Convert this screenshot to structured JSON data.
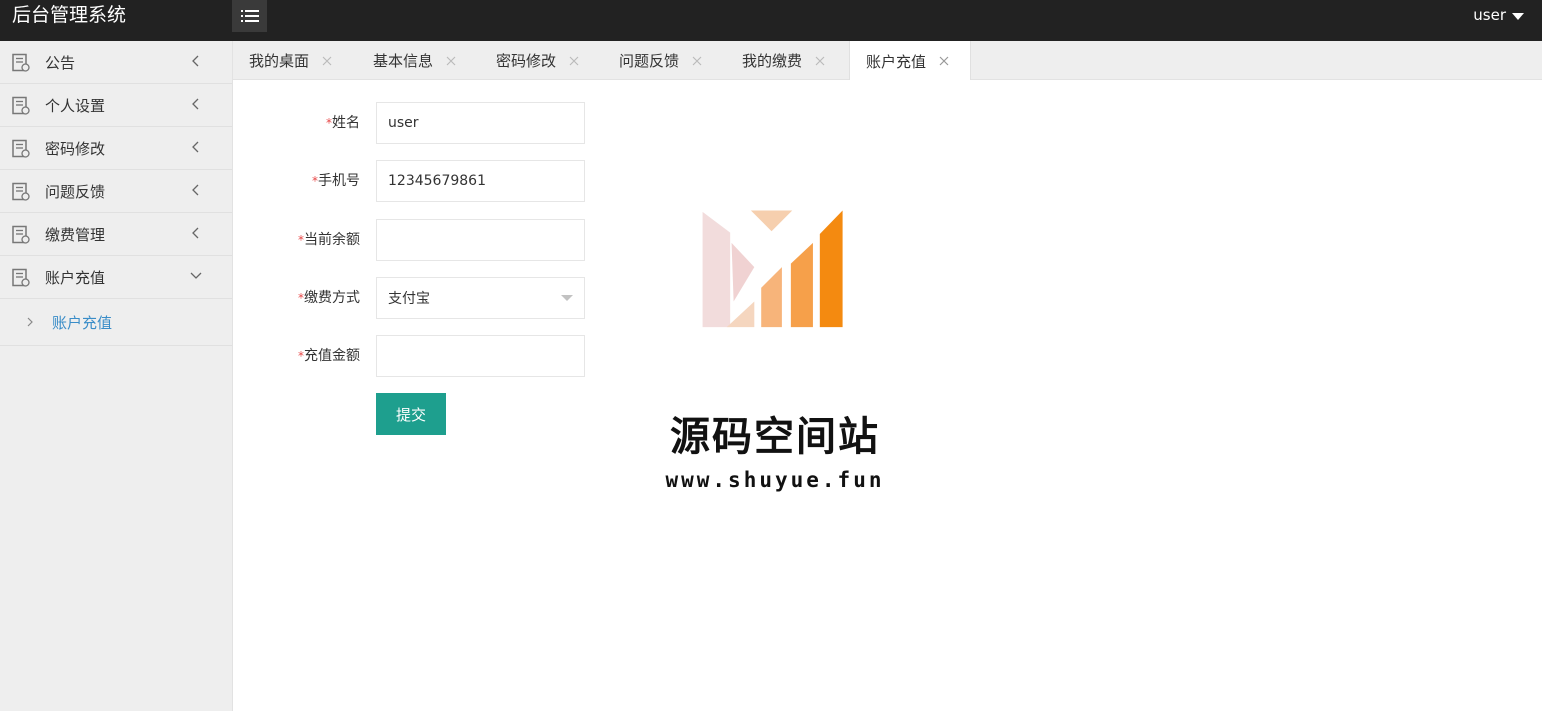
{
  "app": {
    "title": "后台管理系统",
    "menu_icon": "hamburger-icon",
    "user": "user"
  },
  "sidebar": {
    "items": [
      {
        "label": "公告",
        "icon": "document-icon",
        "state": "collapsed"
      },
      {
        "label": "个人设置",
        "icon": "document-icon",
        "state": "collapsed"
      },
      {
        "label": "密码修改",
        "icon": "document-icon",
        "state": "collapsed"
      },
      {
        "label": "问题反馈",
        "icon": "document-icon",
        "state": "collapsed"
      },
      {
        "label": "缴费管理",
        "icon": "document-icon",
        "state": "collapsed"
      },
      {
        "label": "账户充值",
        "icon": "document-icon",
        "state": "expanded"
      }
    ],
    "sub_items": [
      {
        "label": "账户充值",
        "active": true
      }
    ]
  },
  "tabs": [
    {
      "label": "我的桌面",
      "active": false
    },
    {
      "label": "基本信息",
      "active": false
    },
    {
      "label": "密码修改",
      "active": false
    },
    {
      "label": "问题反馈",
      "active": false
    },
    {
      "label": "我的缴费",
      "active": false
    },
    {
      "label": "账户充值",
      "active": true
    }
  ],
  "form": {
    "required_mark": "*",
    "fields": [
      {
        "label": "姓名",
        "value": "user"
      },
      {
        "label": "手机号",
        "value": "12345679861"
      },
      {
        "label": "当前余额",
        "value": ""
      },
      {
        "label": "缴费方式",
        "value": "支付宝"
      },
      {
        "label": "充值金额",
        "value": ""
      }
    ],
    "submit_label": "提交"
  },
  "watermark": {
    "text": "源码空间站",
    "url": "www.shuyue.fun"
  },
  "colors": {
    "topbar": "#222222",
    "sidebar": "#eeeeee",
    "accent_link": "#3a8dc8",
    "button": "#1e9f8e",
    "required": "#e84848"
  }
}
